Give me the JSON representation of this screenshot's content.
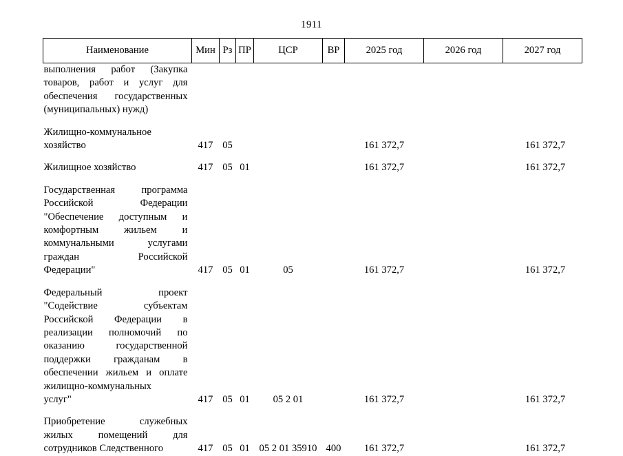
{
  "page": {
    "number": "1911"
  },
  "table": {
    "headers": [
      "Наименование",
      "Мин",
      "Рз",
      "ПР",
      "ЦСР",
      "ВР",
      "2025 год",
      "2026 год",
      "2027 год"
    ],
    "rows": [
      {
        "name_lines": [
          "выполнения работ (Закупка",
          "товаров, работ и услуг для",
          "обеспечения государственных",
          "(муниципальных) нужд)"
        ],
        "name_last_plain": true,
        "min": "",
        "rz": "",
        "pr": "",
        "csr": "",
        "vr": "",
        "y2025": "",
        "y2026": "",
        "y2027": ""
      },
      {
        "name_lines": [
          "Жилищно-коммунальное",
          "хозяйство"
        ],
        "justify": false,
        "min": "417",
        "rz": "05",
        "pr": "",
        "csr": "",
        "vr": "",
        "y2025": "161 372,7",
        "y2026": "",
        "y2027": "161 372,7"
      },
      {
        "name_lines": [
          "Жилищное хозяйство"
        ],
        "justify": false,
        "min": "417",
        "rz": "05",
        "pr": "01",
        "csr": "",
        "vr": "",
        "y2025": "161 372,7",
        "y2026": "",
        "y2027": "161 372,7"
      },
      {
        "name_lines": [
          "Государственная программа",
          "Российской Федерации",
          "\"Обеспечение доступным и",
          "комфортным жильем и",
          "коммунальными услугами",
          "граждан Российской",
          "Федерации\""
        ],
        "name_last_plain": true,
        "min": "417",
        "rz": "05",
        "pr": "01",
        "csr": "05",
        "vr": "",
        "y2025": "161 372,7",
        "y2026": "",
        "y2027": "161 372,7"
      },
      {
        "name_lines": [
          "Федеральный проект",
          "\"Содействие субъектам",
          "Российской Федерации в",
          "реализации полномочий по",
          "оказанию государственной",
          "поддержки гражданам в",
          "обеспечении жильем и оплате",
          "жилищно-коммунальных",
          "услуг\""
        ],
        "name_last_plain": true,
        "name_plain_index": 7,
        "min": "417",
        "rz": "05",
        "pr": "01",
        "csr": "05 2 01",
        "vr": "",
        "y2025": "161 372,7",
        "y2026": "",
        "y2027": "161 372,7"
      },
      {
        "name_lines": [
          "Приобретение служебных",
          "жилых помещений для",
          "сотрудников Следственного"
        ],
        "name_last_plain": false,
        "min": "417",
        "rz": "05",
        "pr": "01",
        "csr": "05 2 01 35910",
        "vr": "400",
        "y2025": "161 372,7",
        "y2026": "",
        "y2027": "161 372,7"
      }
    ]
  }
}
